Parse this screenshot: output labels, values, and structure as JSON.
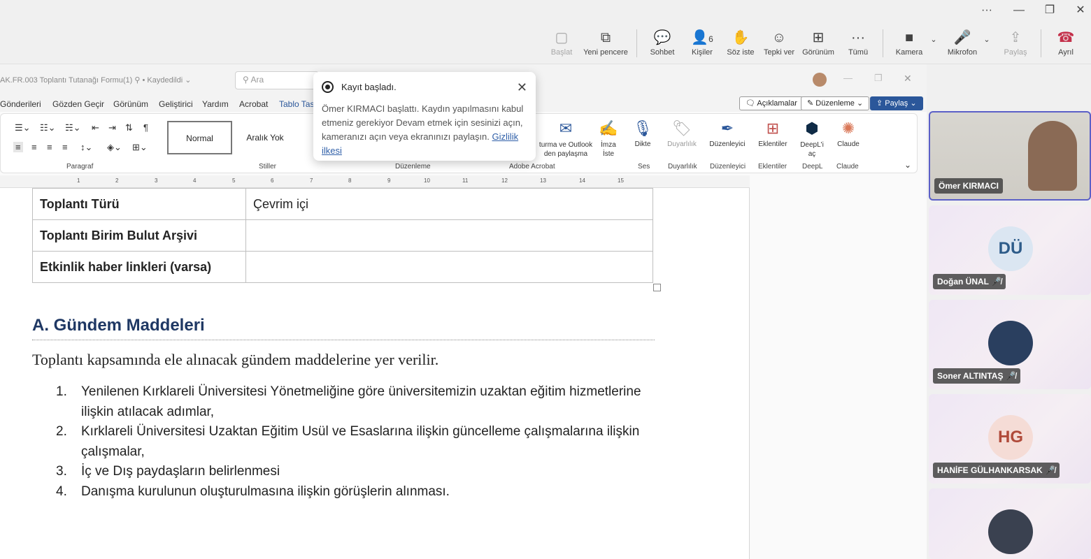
{
  "window": {
    "more": "···",
    "min": "—",
    "max": "❐",
    "close": "✕"
  },
  "teams": {
    "buttons": [
      {
        "label": "Başlat",
        "icon": "▢"
      },
      {
        "label": "Yeni pencere",
        "icon": "⧉"
      },
      {
        "label": "Sohbet",
        "icon": "💬"
      },
      {
        "label": "Kişiler",
        "icon": "👤",
        "badge": "6"
      },
      {
        "label": "Söz iste",
        "icon": "✋"
      },
      {
        "label": "Tepki ver",
        "icon": "☺"
      },
      {
        "label": "Görünüm",
        "icon": "⊞"
      },
      {
        "label": "Tümü",
        "icon": "···"
      },
      {
        "label": "Kamera",
        "icon": "■"
      },
      {
        "label": "Mikrofon",
        "icon": "🎤"
      },
      {
        "label": "Paylaş",
        "icon": "⇪"
      },
      {
        "label": "Ayrıl",
        "icon": "☎"
      }
    ]
  },
  "word": {
    "title": "AK.FR.003 Toplantı Tutanağı Formu(1)  ⚲  • Kaydedildi ⌄",
    "search_placeholder": "Ara",
    "menu": [
      "Gönderileri",
      "Gözden Geçir",
      "Görünüm",
      "Geliştirici",
      "Yardım",
      "Acrobat",
      "Tablo Tas"
    ],
    "comments_btn": "Açıklamalar",
    "edit_btn": "Düzenleme ⌄",
    "share_btn": "Paylaş ⌄",
    "styles": [
      "Normal",
      "Aralık Yok"
    ],
    "groups": {
      "paragraph": "Paragraf",
      "styles": "Stiller",
      "editing": "Düzenleme",
      "acrobat": "Adobe Acrobat",
      "voice": "Ses",
      "sensitivity": "Duyarlılık",
      "editor": "Düzenleyici",
      "addins": "Eklentiler",
      "deepl": "DeepL",
      "claude": "Claude"
    },
    "ribbon_buttons": {
      "outlook": "turma ve Outlook\nden paylaşma",
      "sign": "İmza\nİste",
      "dictate": "Dikte",
      "sensitivity": "Duyarlılık",
      "editor": "Düzenleyici",
      "addins": "Eklentiler",
      "deepl": "DeepL'i\naç",
      "claude": "Claude"
    },
    "ruler": [
      "1",
      "2",
      "3",
      "4",
      "5",
      "6",
      "7",
      "8",
      "9",
      "10",
      "11",
      "12",
      "13",
      "14",
      "15"
    ]
  },
  "doc": {
    "table": [
      {
        "key": "Toplantı Türü",
        "value": "Çevrim içi"
      },
      {
        "key": "Toplantı Birim Bulut Arşivi",
        "value": ""
      },
      {
        "key": "Etkinlik haber linkleri (varsa)",
        "value": ""
      }
    ],
    "heading": "A. Gündem Maddeleri",
    "intro": "Toplantı kapsamında ele alınacak gündem maddelerine yer verilir.",
    "items": [
      {
        "n": "1.",
        "text": "Yenilenen Kırklareli Üniversitesi Yönetmeliğine göre üniversitemizin uzaktan eğitim hizmetlerine ilişkin atılacak adımlar,"
      },
      {
        "n": "2.",
        "text": "Kırklareli Üniversitesi Uzaktan Eğitim Usül ve Esaslarına ilişkin güncelleme çalışmalarına ilişkin çalışmalar,"
      },
      {
        "n": "3.",
        "text": "İç ve Dış paydaşların belirlenmesi"
      },
      {
        "n": "4.",
        "text": "Danışma kurulunun oluşturulmasına ilişkin görüşlerin alınması."
      }
    ]
  },
  "toast": {
    "title": "Kayıt başladı.",
    "body": "Ömer KIRMACI başlattı. Kaydın yapılmasını kabul etmeniz gerekiyor Devam etmek için sesinizi açın, kameranızı açın veya ekranınızı paylaşın.",
    "link": "Gizlilik ilkesi"
  },
  "participants": [
    {
      "name": "Ömer KIRMACI",
      "initials": "",
      "muted": false
    },
    {
      "name": "Doğan ÜNAL",
      "initials": "DÜ",
      "muted": true
    },
    {
      "name": "Soner ALTINTAŞ",
      "initials": "",
      "muted": true
    },
    {
      "name": "HANİFE GÜLHANKARSAK",
      "initials": "HG",
      "muted": true
    }
  ]
}
